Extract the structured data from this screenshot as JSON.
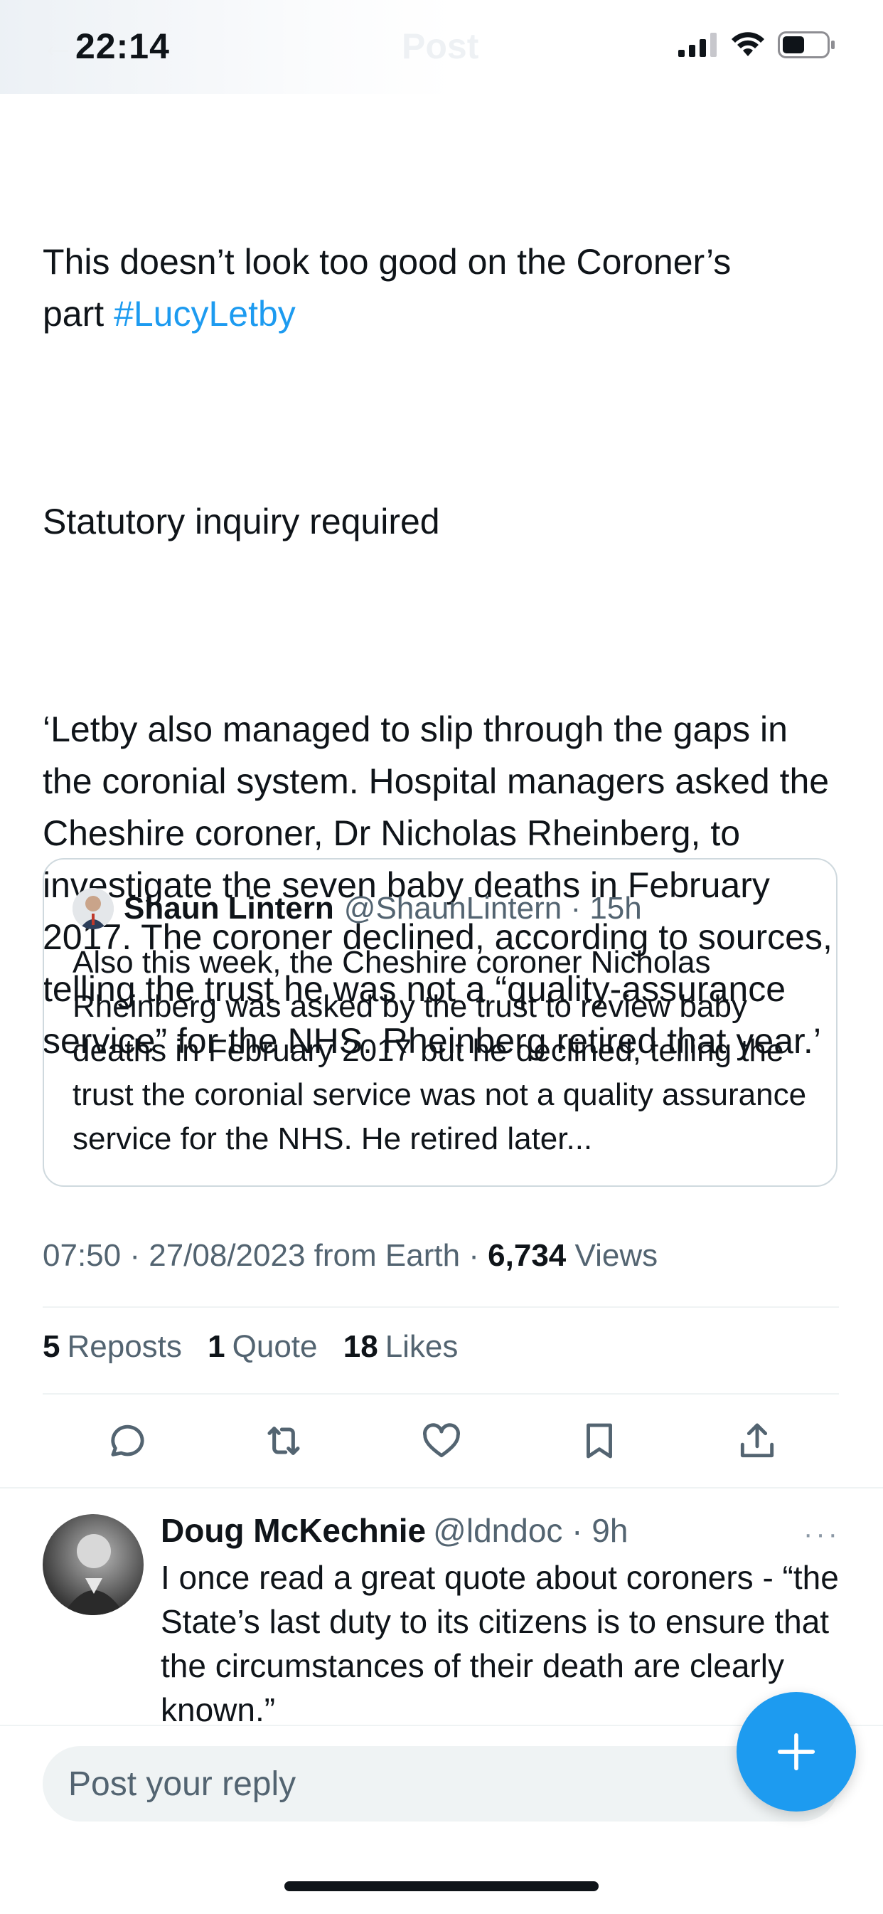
{
  "status_bar": {
    "time": "22:14",
    "header_title": "Post",
    "icons": [
      "signal-icon",
      "wifi-icon",
      "battery-icon"
    ]
  },
  "tweet": {
    "text_line1": "This doesn’t look too good on the Coroner’s",
    "text_line2_prefix": "part ",
    "hashtag": "#LucyLetby",
    "paragraph2": "Statutory inquiry required",
    "paragraph3": "‘Letby also managed to slip through the gaps in the coronial system. Hospital managers asked the Cheshire coroner, Dr Nicholas Rheinberg, to investigate the seven baby deaths in February 2017. The coroner declined, according to sources, telling the trust he was not a “quality-assurance service” for the NHS. Rheinberg retired that year.’",
    "meta": {
      "time": "07:50",
      "date": "27/08/2023",
      "source": "from Earth",
      "views_count": "6,734",
      "views_label": "Views"
    },
    "stats": {
      "reposts_count": "5",
      "reposts_label": "Reposts",
      "quotes_count": "1",
      "quotes_label": "Quote",
      "likes_count": "18",
      "likes_label": "Likes"
    }
  },
  "quoted_tweet": {
    "name": "Shaun Lintern",
    "handle": "@ShaunLintern",
    "time": "15h",
    "text": "Also this week, the Cheshire coroner Nicholas Rheinberg was asked by the trust to review baby deaths in February 2017 but he declined, telling the trust the coronial service was not a quality assurance service for the NHS. He retired later..."
  },
  "actions": [
    "reply-icon",
    "repost-icon",
    "like-icon",
    "bookmark-icon",
    "share-icon"
  ],
  "reply": {
    "name": "Doug McKechnie",
    "handle": "@ldndoc",
    "time": "9h",
    "more": "···",
    "text": "I once read a great quote about coroners - “the State’s last duty to its citizens is to ensure that the circumstances of their death are clearly known.”"
  },
  "compose": {
    "placeholder": "Post your reply",
    "fab_icon": "plus-icon"
  },
  "colors": {
    "accent": "#1d9bf0",
    "text": "#0f1419",
    "secondary": "#536471",
    "border": "#cfd9de"
  }
}
